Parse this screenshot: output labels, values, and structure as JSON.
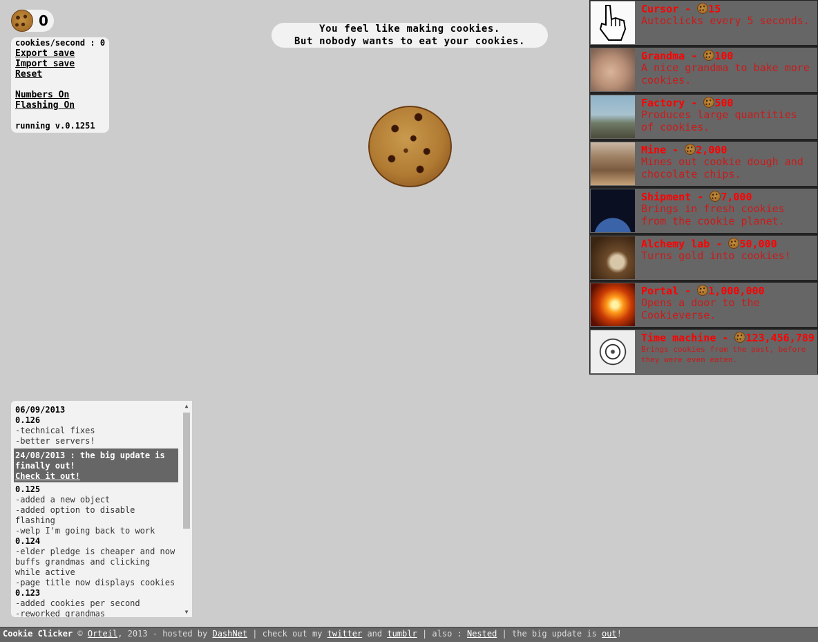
{
  "counter": {
    "icon": "cookie-icon",
    "value": "0"
  },
  "menu": {
    "cps": "cookies/second : 0",
    "export": "Export save",
    "import": "Import save",
    "reset": "Reset",
    "numbers": "Numbers On",
    "flashing": "Flashing On",
    "version": "running v.0.1251"
  },
  "message": {
    "line1": "You feel like making cookies.",
    "line2": "But nobody wants to eat your cookies."
  },
  "big_cookie": {
    "icon": "big-cookie"
  },
  "store": {
    "colors": {
      "title": "#ff0000",
      "desc": "#cc1a1a",
      "bg": "#666666"
    },
    "items": [
      {
        "name": "Cursor",
        "sep": " - ",
        "price": "15",
        "desc": "Autoclicks every 5 seconds."
      },
      {
        "name": "Grandma",
        "sep": " - ",
        "price": "100",
        "desc": "A nice grandma to bake more cookies."
      },
      {
        "name": "Factory",
        "sep": " - ",
        "price": "500",
        "desc": "Produces large quantities of cookies."
      },
      {
        "name": "Mine",
        "sep": " - ",
        "price": "2,000",
        "desc": "Mines out cookie dough and chocolate chips."
      },
      {
        "name": "Shipment",
        "sep": " - ",
        "price": "7,000",
        "desc": "Brings in fresh cookies from the cookie planet."
      },
      {
        "name": "Alchemy lab",
        "sep": " - ",
        "price": "50,000",
        "desc": "Turns gold into cookies!"
      },
      {
        "name": "Portal",
        "sep": " - ",
        "price": "1,000,000",
        "desc": "Opens a door to the Cookieverse."
      },
      {
        "name": "Time machine",
        "sep": " - ",
        "price": "123,456,789",
        "desc": "Brings cookies from the past, before they were even eaten."
      }
    ]
  },
  "log": {
    "date1": "06/09/2013",
    "v126": "0.126",
    "v126_1": "-technical fixes",
    "v126_2": "-better servers!",
    "announce": "24/08/2013 : the big update is finally out!",
    "announce_link": "Check it out!",
    "v125": "0.125",
    "v125_1": "-added a new object",
    "v125_2": "-added option to disable flashing",
    "v125_3": "-welp I'm going back to work",
    "v124": "0.124",
    "v124_1": "-elder pledge is cheaper and now buffs grandmas and clicking while active",
    "v124_2": "-page title now displays cookies",
    "v123": "0.123",
    "v123_1": "-added cookies per second",
    "v123_2": "-reworked grandmas"
  },
  "footer": {
    "brand": "Cookie Clicker",
    "copy": " © ",
    "author": "Orteil",
    "t1": ", 2013 - hosted by ",
    "host": "DashNet",
    "t2": " | check out my ",
    "twitter": "twitter",
    "t3": " and ",
    "tumblr": "tumblr",
    "t4": " | also : ",
    "nested": "Nested",
    "t5": " | the big update is ",
    "out": "out",
    "t6": "!"
  }
}
